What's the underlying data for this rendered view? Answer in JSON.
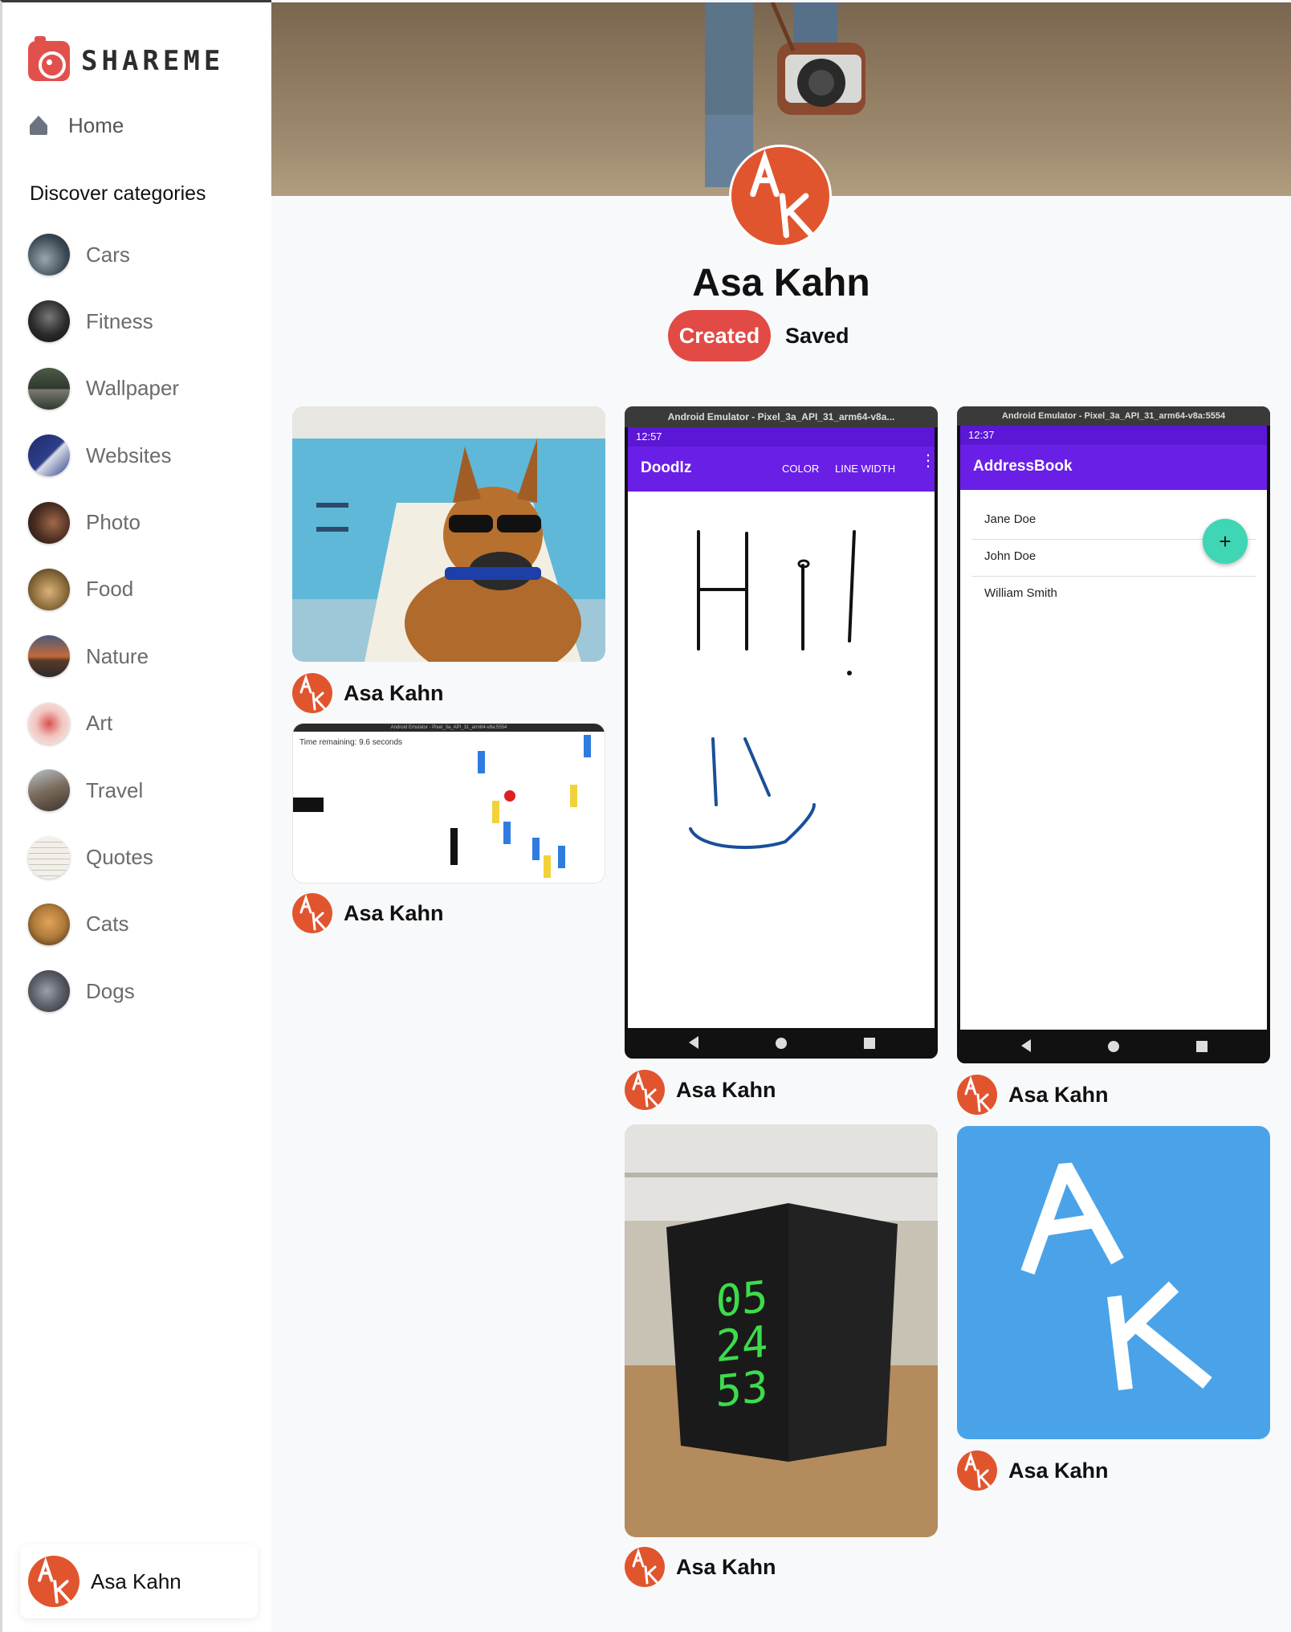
{
  "app": {
    "logo_text": "SHAREME"
  },
  "sidebar": {
    "home_label": "Home",
    "discover_heading": "Discover categories",
    "categories": [
      {
        "label": "Cars",
        "color": "#3c4a55"
      },
      {
        "label": "Fitness",
        "color": "#2a2a2a"
      },
      {
        "label": "Wallpaper",
        "color": "#2f3a2e"
      },
      {
        "label": "Websites",
        "color": "#2e3f8a"
      },
      {
        "label": "Photo",
        "color": "#4a2e22"
      },
      {
        "label": "Food",
        "color": "#8a6a3a"
      },
      {
        "label": "Nature",
        "color": "#c46a3a"
      },
      {
        "label": "Art",
        "color": "#d9534f"
      },
      {
        "label": "Travel",
        "color": "#7a6a5a"
      },
      {
        "label": "Quotes",
        "color": "#e8e4dc"
      },
      {
        "label": "Cats",
        "color": "#b07a3a"
      },
      {
        "label": "Dogs",
        "color": "#5a5e66"
      }
    ],
    "user_name": "Asa Kahn"
  },
  "profile": {
    "name": "Asa Kahn",
    "tab_created": "Created",
    "tab_saved": "Saved"
  },
  "pins": [
    {
      "author": "Asa Kahn"
    },
    {
      "author": "Asa Kahn",
      "game_text": "Time remaining: 9.6 seconds",
      "window_title": "Android Emulator - Pixel_3a_API_31_arm64-v8a:5554"
    },
    {
      "author": "Asa Kahn",
      "window_title": "Android Emulator - Pixel_3a_API_31_arm64-v8a...",
      "time": "12:57",
      "app_title": "Doodlz",
      "action_color": "COLOR",
      "action_width": "LINE WIDTH"
    },
    {
      "author": "Asa Kahn",
      "window_title": "Android Emulator - Pixel_3a_API_31_arm64-v8a:5554",
      "time": "12:37",
      "app_title": "AddressBook",
      "contacts": [
        "Jane Doe",
        "John Doe",
        "William Smith"
      ]
    },
    {
      "author": "Asa Kahn",
      "clock": [
        "05",
        "24",
        "53"
      ]
    },
    {
      "author": "Asa Kahn"
    }
  ],
  "colors": {
    "accent": "#e24a46",
    "avatar": "#e0552e",
    "android_purple": "#6a1fe6",
    "fab_teal": "#3ed6b4",
    "ak_blue": "#4aa3e8"
  }
}
